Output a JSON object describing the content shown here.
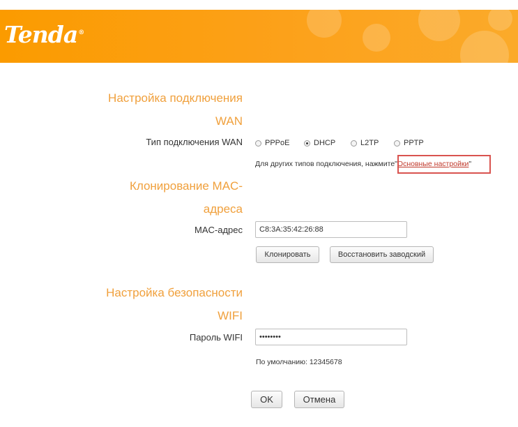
{
  "header": {
    "logo_text": "Tenda",
    "logo_mark": "®",
    "brand_color": "#fb9b00"
  },
  "wan": {
    "title_line1": "Настройка подключения",
    "title_line2": "WAN",
    "type_label": "Тип подключения WAN",
    "options": [
      "PPPoE",
      "DHCP",
      "L2TP",
      "PPTP"
    ],
    "selected": "DHCP",
    "hint_prefix": "Для других типов подключения, нажмите",
    "hint_link": "Основные настройки",
    "quote_open": "\"",
    "quote_close": "\""
  },
  "mac": {
    "title_line1": "Клонирование MAC-",
    "title_line2": "адреса",
    "label": "MAC-адрес",
    "value": "C8:3A:35:42:26:88",
    "clone_button": "Клонировать",
    "restore_button": "Восстановить заводский"
  },
  "wifi": {
    "title_line1": "Настройка безопасности",
    "title_line2": "WIFI",
    "password_label": "Пароль WIFI",
    "password_value": "12345678",
    "default_hint": "По умолчанию: 12345678"
  },
  "actions": {
    "ok": "OK",
    "cancel": "Отмена"
  },
  "colors": {
    "section_title": "#f0a03c",
    "highlight": "#d9534f",
    "link": "#c0392b"
  }
}
